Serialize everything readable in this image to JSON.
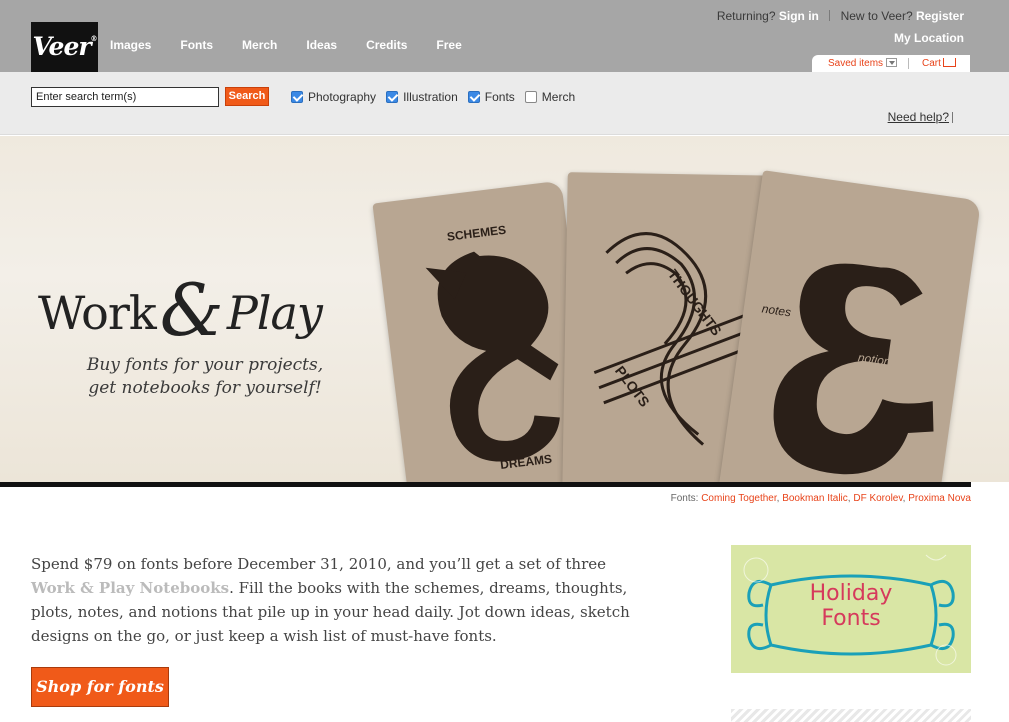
{
  "header": {
    "logo": "Veer",
    "logo_mark": "®",
    "nav": [
      "Images",
      "Fonts",
      "Merch",
      "Ideas",
      "Credits",
      "Free"
    ],
    "returning_label": "Returning?",
    "sign_in": "Sign in",
    "new_label": "New to Veer?",
    "register": "Register",
    "my_location": "My Location",
    "saved_items": "Saved items",
    "cart": "Cart"
  },
  "search": {
    "placeholder": "Enter search term(s)",
    "button": "Search",
    "filters": [
      {
        "label": "Photography",
        "checked": true
      },
      {
        "label": "Illustration",
        "checked": true
      },
      {
        "label": "Fonts",
        "checked": true
      },
      {
        "label": "Merch",
        "checked": false
      }
    ],
    "need_help": "Need help?"
  },
  "hero": {
    "title_work": "Work",
    "title_amp": "&",
    "title_play": "Play",
    "subtitle_line1": "Buy fonts for your projects,",
    "subtitle_line2": "get notebooks for yourself!",
    "book1_top": "SCHEMES",
    "book1_bottom": "DREAMS",
    "book2_a": "THOUGHTS",
    "book2_b": "PLOTS",
    "book3_a": "notes",
    "book3_b": "notions"
  },
  "credits": {
    "label": "Fonts:",
    "fonts": [
      "Coming Together",
      "Bookman Italic",
      "DF Korolev",
      "Proxima Nova"
    ]
  },
  "promo": {
    "text_before": "Spend $79 on fonts before December 31, 2010, and you’ll get a set of three",
    "link": "Work & Play Notebooks",
    "text_after": ". Fill the books with the schemes, dreams, thoughts, plots, notes, and notions that pile up in your head daily. Jot down ideas, sketch designs on the go, or just keep a wish list of must-have fonts.",
    "button": "Shop for fonts"
  },
  "sidebar": {
    "holiday_line1": "Holiday",
    "holiday_line2": "Fonts"
  }
}
